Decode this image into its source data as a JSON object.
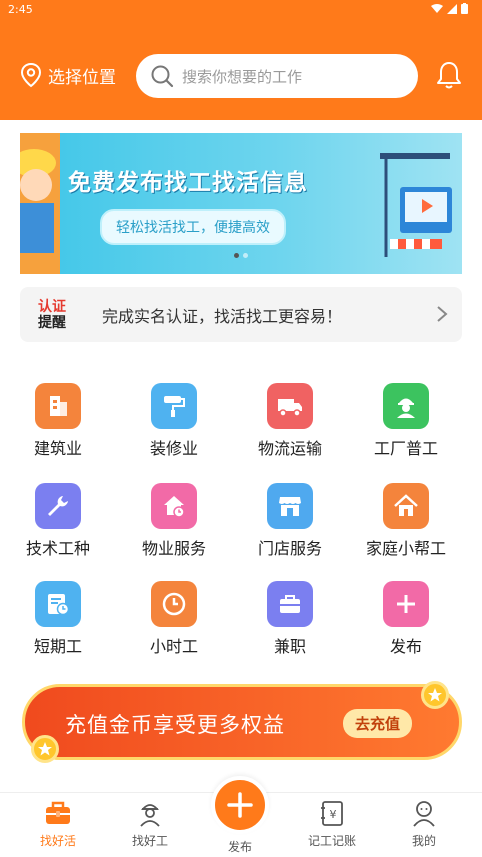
{
  "status": {
    "time": "2:45"
  },
  "header": {
    "location_label": "选择位置",
    "search_placeholder": "搜索你想要的工作"
  },
  "banner": {
    "title": "免费发布找工找活信息",
    "subtitle": "轻松找活找工，便捷高效"
  },
  "notice": {
    "badge_line1": "认证",
    "badge_line2": "提醒",
    "text": "完成实名认证，找活找工更容易！"
  },
  "categories": [
    {
      "label": "建筑业",
      "icon": "building-icon",
      "color": "#f4843c"
    },
    {
      "label": "装修业",
      "icon": "paint-roller-icon",
      "color": "#4fb2f0"
    },
    {
      "label": "物流运输",
      "icon": "truck-icon",
      "color": "#f06262"
    },
    {
      "label": "工厂普工",
      "icon": "worker-icon",
      "color": "#3cc35f"
    },
    {
      "label": "技术工种",
      "icon": "wrench-icon",
      "color": "#7b7ff0"
    },
    {
      "label": "物业服务",
      "icon": "house-clock-icon",
      "color": "#f26aa7"
    },
    {
      "label": "门店服务",
      "icon": "store-icon",
      "color": "#4fa9ef"
    },
    {
      "label": "家庭小帮工",
      "icon": "home-icon",
      "color": "#f4843c"
    },
    {
      "label": "短期工",
      "icon": "calendar-clock-icon",
      "color": "#4fb2f0"
    },
    {
      "label": "小时工",
      "icon": "clock-icon",
      "color": "#f4843c"
    },
    {
      "label": "兼职",
      "icon": "briefcase-icon",
      "color": "#7b7ff0"
    },
    {
      "label": "发布",
      "icon": "plus-icon",
      "color": "#f26aa7"
    }
  ],
  "promo": {
    "text": "充值金币享受更多权益",
    "button": "去充值"
  },
  "tabbar": {
    "tabs": [
      {
        "label": "找好活",
        "icon": "toolbox-icon",
        "active": true
      },
      {
        "label": "找好工",
        "icon": "worker-person-icon",
        "active": false
      },
      {
        "label": "发布",
        "icon": "plus-icon",
        "active": false
      },
      {
        "label": "记工记账",
        "icon": "ledger-icon",
        "active": false
      },
      {
        "label": "我的",
        "icon": "profile-icon",
        "active": false
      }
    ]
  },
  "colors": {
    "primary": "#ff7a1a"
  }
}
